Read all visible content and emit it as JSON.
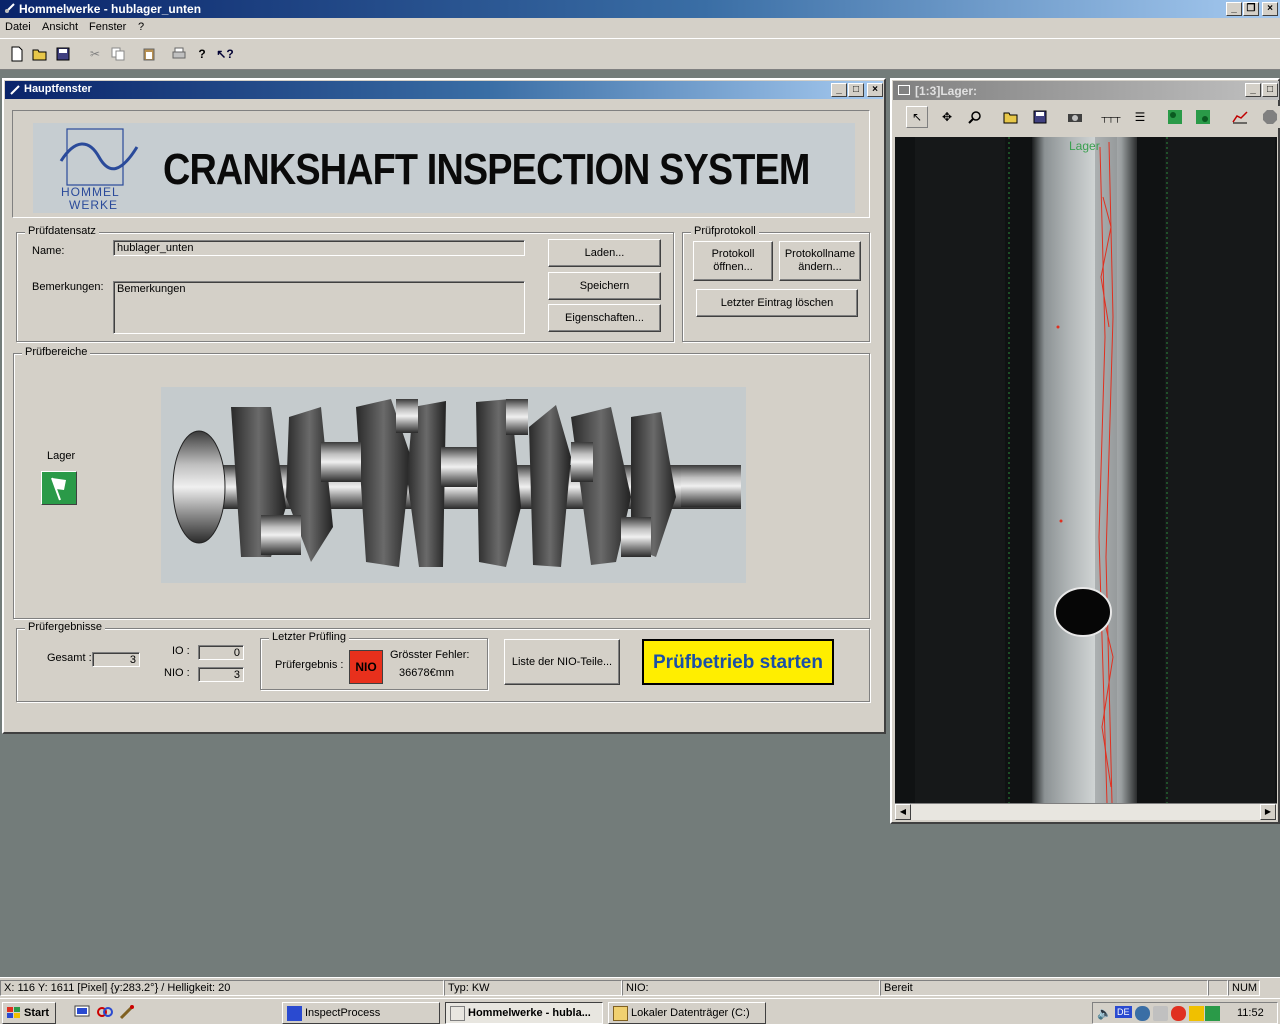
{
  "app": {
    "title": "Hommelwerke - hublager_unten",
    "menu": [
      "Datei",
      "Ansicht",
      "Fenster",
      "?"
    ]
  },
  "toolbar": {
    "icons": [
      "new-file-icon",
      "open-folder-icon",
      "save-icon",
      "cut-icon",
      "copy-icon",
      "paste-icon",
      "print-icon",
      "help-icon",
      "context-help-icon"
    ]
  },
  "main_window": {
    "title": "Hauptfenster",
    "banner": {
      "title": "CRANKSHAFT INSPECTION SYSTEM",
      "logo_line1": "HOMMEL",
      "logo_line2": "WERKE"
    },
    "pruefdatensatz": {
      "group_label": "Prüfdatensatz",
      "name_label": "Name:",
      "name_value": "hublager_unten",
      "remarks_label": "Bemerkungen:",
      "remarks_value": "Bemerkungen",
      "buttons": {
        "load": "Laden...",
        "save": "Speichern",
        "properties": "Eigenschaften..."
      }
    },
    "pruefprotokoll": {
      "group_label": "Prüfprotokoll",
      "open_line1": "Protokoll",
      "open_line2": "öffnen...",
      "rename_line1": "Protokollname",
      "rename_line2": "ändern...",
      "delete_last": "Letzter Eintrag löschen"
    },
    "pruefbereiche": {
      "group_label": "Prüfbereiche",
      "lager_label": "Lager"
    },
    "results": {
      "group_label": "Prüfergebnisse",
      "total_label": "Gesamt :",
      "total_value": "3",
      "io_label": "IO :",
      "io_value": "0",
      "nio_label": "NIO :",
      "nio_value": "3",
      "last_part_label": "Letzter Prüfling",
      "result_label": "Prüfergebnis :",
      "result_value": "NIO",
      "max_error_label": "Grösster Fehler:",
      "max_error_value": "36678€mm",
      "nio_list_button": "Liste der NIO-Teile...",
      "start_button": "Prüfbetrieb starten"
    }
  },
  "image_window": {
    "title": "[1:3]Lager:",
    "overlay_label": "Lager",
    "toolbar_icons": [
      "pointer-icon",
      "move-icon",
      "zoom-icon",
      "open-folder-icon",
      "save-icon",
      "camera-icon",
      "ruler-icon",
      "list-icon",
      "tree-icon",
      "tree-active-icon",
      "chart-icon",
      "stop-icon"
    ]
  },
  "statusbar": {
    "position": "X:  116 Y: 1611 [Pixel]  {y:283.2°} / Helligkeit:  20",
    "type": "Typ: KW",
    "nio": "NIO:",
    "state": "Bereit",
    "num": "NUM"
  },
  "taskbar": {
    "start": "Start",
    "tasks": [
      {
        "label": "InspectProcess",
        "active": false
      },
      {
        "label": "Hommelwerke - hubla...",
        "active": true
      },
      {
        "label": "Lokaler Datenträger (C:)",
        "active": false
      }
    ],
    "tray_lang": "DE",
    "clock": "11:52"
  },
  "colors": {
    "nio_red": "#e8301c",
    "start_yellow": "#ffee00",
    "start_text": "#1a4fa8",
    "title_blue": "#0a246a"
  }
}
